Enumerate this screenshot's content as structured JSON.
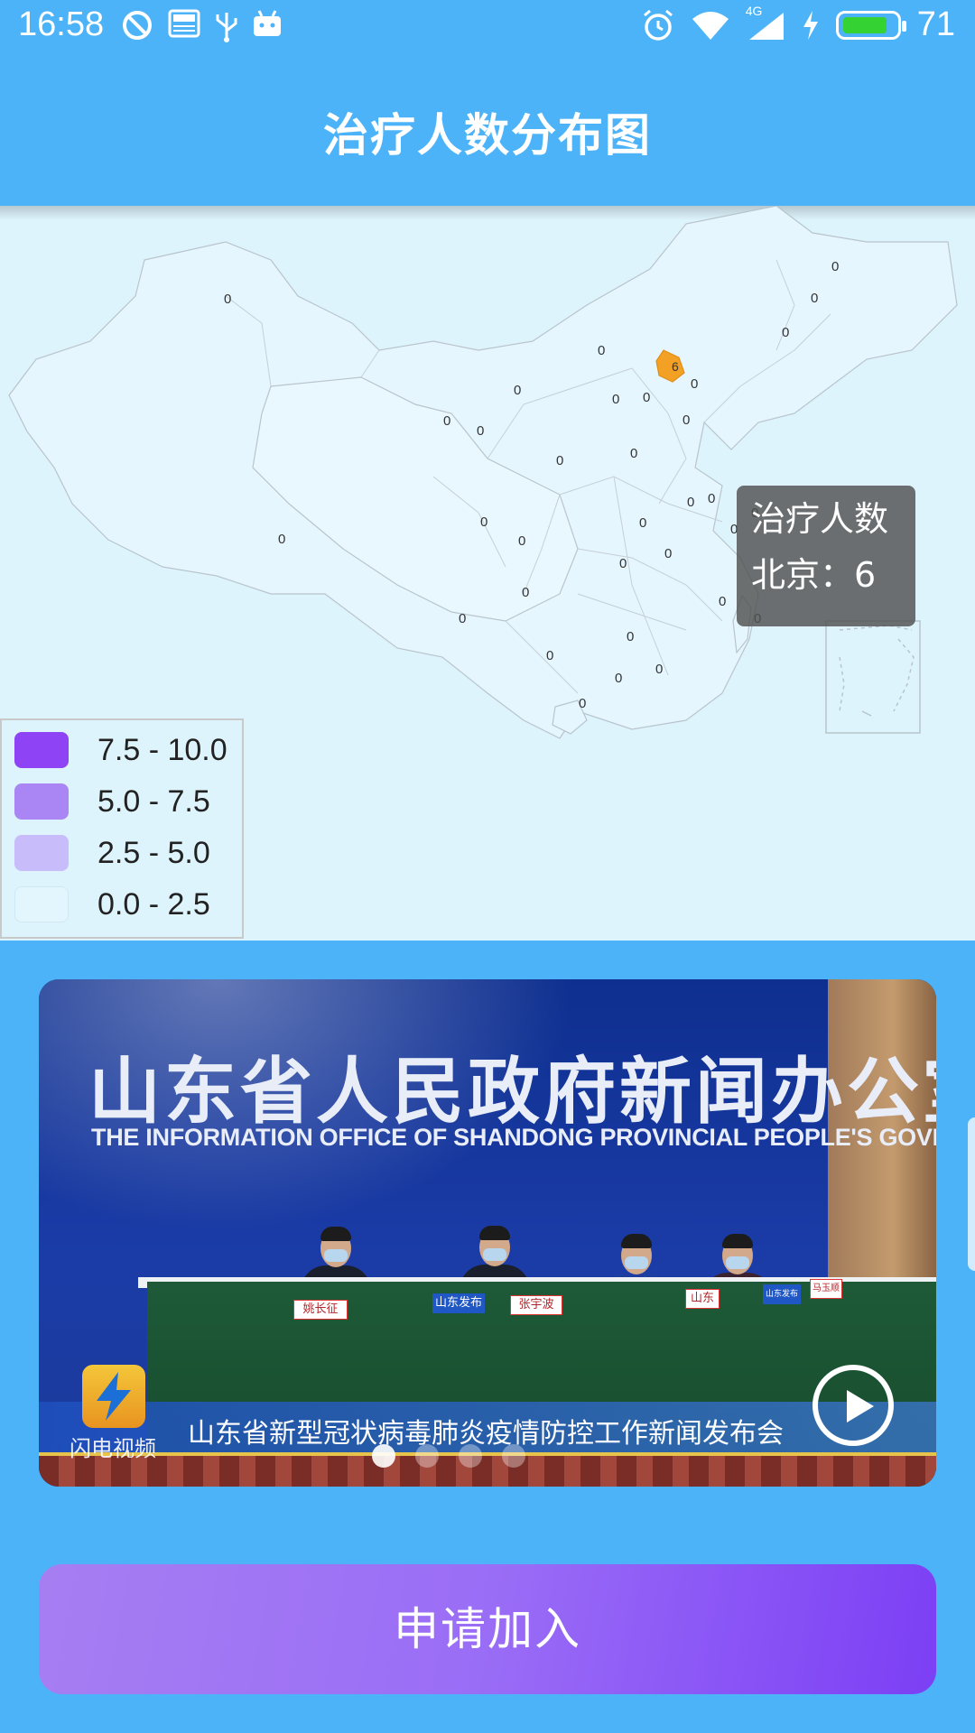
{
  "status_bar": {
    "time": "16:58",
    "network": "4G",
    "battery_level": "71",
    "battery_color": "#35d233",
    "left_icons": [
      "do-not-disturb-icon",
      "news-icon",
      "usb-icon",
      "android-icon"
    ],
    "right_icons": [
      "alarm-icon",
      "wifi-icon",
      "signal-icon",
      "charging-icon",
      "battery-icon"
    ]
  },
  "app_bar": {
    "title": "治疗人数分布图",
    "background": "#4db3f8"
  },
  "map": {
    "tooltip": {
      "series": "治疗人数",
      "value_line": "北京：6"
    },
    "region_values": [
      "0",
      "0",
      "0",
      "0",
      "0",
      "6",
      "0",
      "0",
      "0",
      "0",
      "0",
      "0",
      "0",
      "0",
      "0",
      "0",
      "0",
      "0",
      "0",
      "0",
      "0",
      "0",
      "0",
      "0",
      "0",
      "0",
      "0",
      "0",
      "0",
      "0",
      "0",
      "0",
      "0",
      "0"
    ],
    "highlight": {
      "region": "北京",
      "value": "6",
      "color": "#f3a125"
    },
    "legend": [
      {
        "label": "7.5 - 10.0",
        "color": "#8e43f5"
      },
      {
        "label": "5.0 - 7.5",
        "color": "#aa86f5"
      },
      {
        "label": "2.5 - 5.0",
        "color": "#c8bcfa"
      },
      {
        "label": "0.0 - 2.5",
        "color": "#e3f6fe"
      }
    ]
  },
  "banner": {
    "headline_cn": "山东省人民政府新闻办公室",
    "headline_en": "THE INFORMATION OFFICE OF SHANDONG PROVINCIAL PEOPLE'S GOVERNMENT",
    "caption": "山东省新型冠状病毒肺炎疫情防控工作新闻发布会",
    "watermark": "闪电视频",
    "nameplates": [
      "姚长征",
      "山东发布",
      "张宇波",
      "山东",
      "山东发布",
      "马玉顺"
    ],
    "slides_total": 4,
    "active_slide": 1
  },
  "actions": {
    "join_label": "申请加入"
  }
}
